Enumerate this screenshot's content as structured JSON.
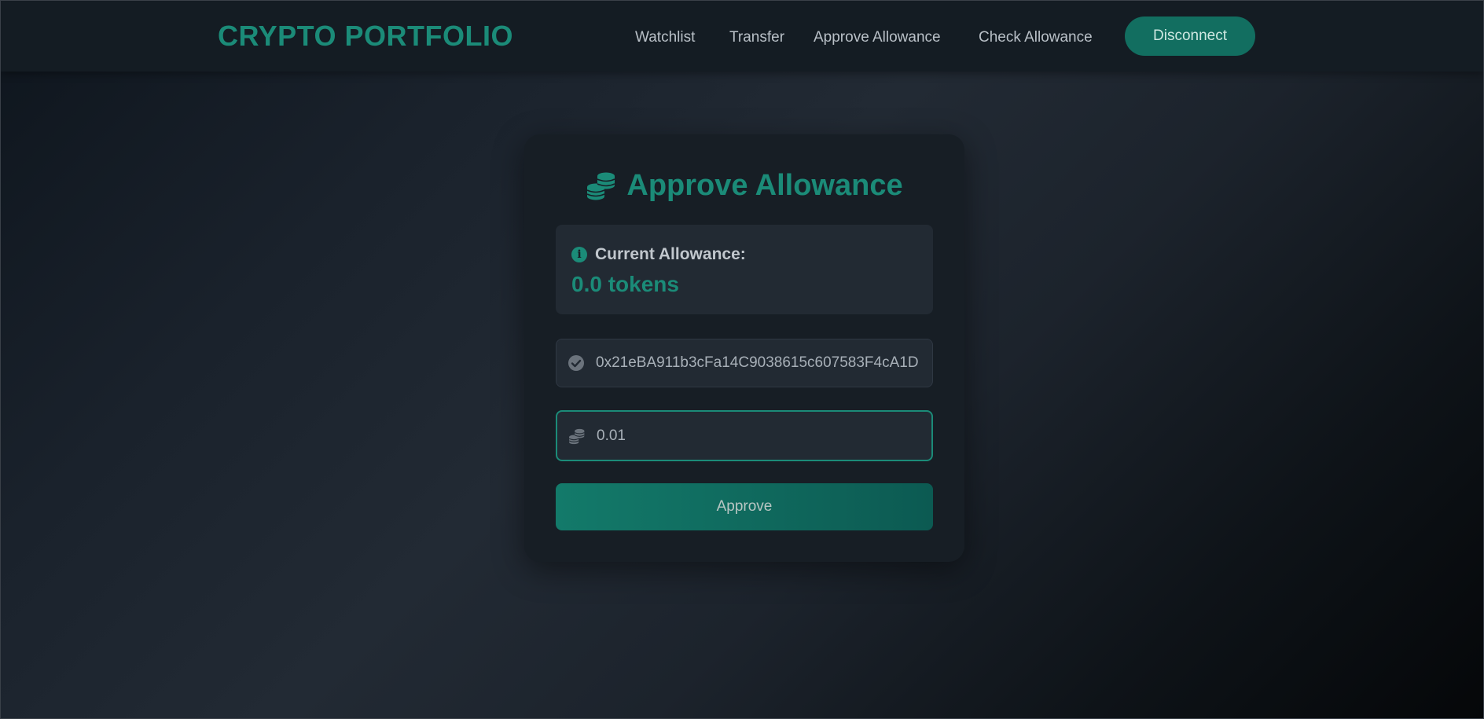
{
  "navbar": {
    "brand": "CRYPTO PORTFOLIO",
    "links": [
      {
        "label": "Watchlist"
      },
      {
        "label": "Transfer"
      },
      {
        "label": "Approve Allowance"
      },
      {
        "label": "Check Allowance"
      }
    ],
    "disconnect_label": "Disconnect"
  },
  "card": {
    "title": "Approve Allowance",
    "title_icon": "coins-icon",
    "allowance": {
      "label": "Current Allowance:",
      "value": "0.0 tokens",
      "icon": "info-circle-icon"
    },
    "address_field": {
      "value": "0x21eBA911b3cFa14C9038615c607583F4cA1D",
      "icon": "check-circle-icon"
    },
    "amount_field": {
      "value": "0.01",
      "icon": "coins-icon"
    },
    "approve_label": "Approve"
  },
  "colors": {
    "accent": "#1b8b78",
    "button": "#126e60",
    "card_bg": "#171e25",
    "navbar_bg": "#141c23"
  }
}
